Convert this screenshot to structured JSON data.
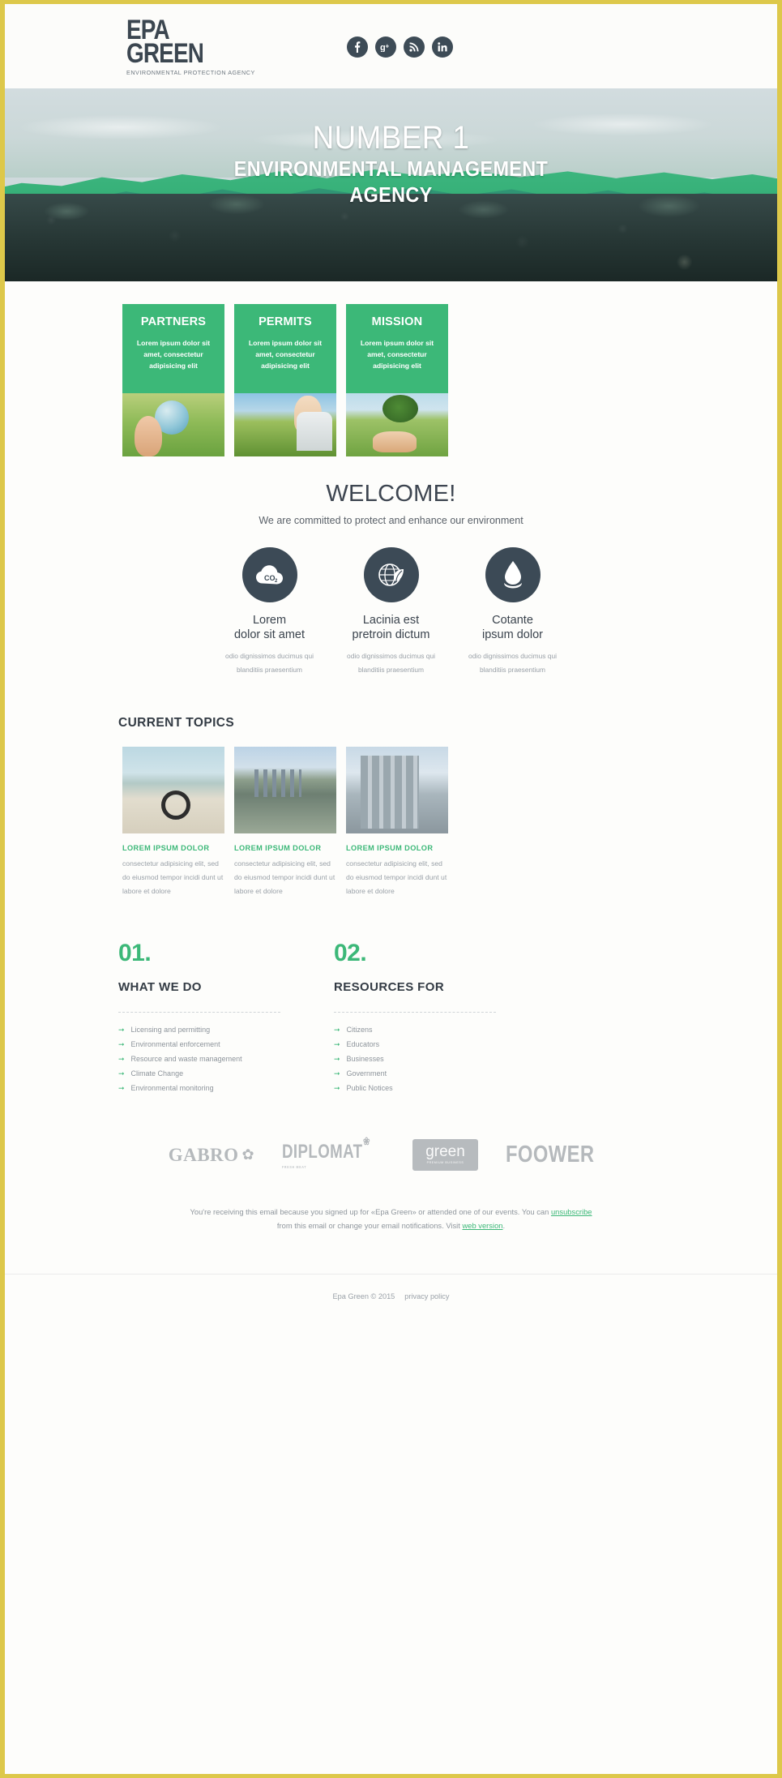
{
  "brand": {
    "logo_line1": "EPA",
    "logo_line2": "GREEN",
    "logo_tagline": "ENVIRONMENTAL PROTECTION AGENCY"
  },
  "social": [
    {
      "name": "facebook-icon",
      "glyph": "f"
    },
    {
      "name": "google-plus-icon",
      "glyph": "g+"
    },
    {
      "name": "rss-icon",
      "glyph": "◜"
    },
    {
      "name": "linkedin-icon",
      "glyph": "in"
    }
  ],
  "hero": {
    "title": "NUMBER 1",
    "subtitle_line1": "ENVIRONMENTAL MANAGEMENT",
    "subtitle_line2": "AGENCY"
  },
  "cards": [
    {
      "title": "PARTNERS",
      "text": "Lorem ipsum dolor sit amet, consectetur adipisicing elit",
      "image_name": "hand-holding-globe-photo"
    },
    {
      "title": "PERMITS",
      "text": "Lorem ipsum dolor sit amet, consectetur adipisicing elit",
      "image_name": "scientist-in-field-photo"
    },
    {
      "title": "MISSION",
      "text": "Lorem ipsum dolor sit amet, consectetur adipisicing elit",
      "image_name": "hands-planting-sapling-photo"
    }
  ],
  "welcome": {
    "title": "WELCOME!",
    "subtitle": "We are committed to protect and enhance our environment"
  },
  "features": [
    {
      "icon": "co2-cloud-icon",
      "title_line1": "Lorem",
      "title_line2": "dolor sit amet",
      "desc_line1": "odio dignissimos ducimus qui",
      "desc_line2": "blanditiis praesentium"
    },
    {
      "icon": "globe-leaf-icon",
      "title_line1": "Lacinia est",
      "title_line2": "pretroin dictum",
      "desc_line1": "odio dignissimos ducimus qui",
      "desc_line2": "blanditiis praesentium"
    },
    {
      "icon": "water-drop-icon",
      "title_line1": "Cotante",
      "title_line2": "ipsum dolor",
      "desc_line1": "odio dignissimos ducimus qui",
      "desc_line2": "blanditiis praesentium"
    }
  ],
  "topics_section": {
    "heading": "CURRENT TOPICS",
    "items": [
      {
        "image_name": "beach-with-tire-photo",
        "title": "LOREM IPSUM DOLOR",
        "text": "consectetur adipisicing elit, sed do eiusmod tempor incidi dunt ut labore et dolore"
      },
      {
        "image_name": "polluted-river-city-photo",
        "title": "LOREM IPSUM DOLOR",
        "text": "consectetur adipisicing elit, sed do eiusmod tempor incidi dunt ut labore et dolore"
      },
      {
        "image_name": "skyscrapers-photo",
        "title": "LOREM IPSUM DOLOR",
        "text": "consectetur adipisicing elit, sed do eiusmod tempor incidi dunt ut labore et dolore"
      }
    ]
  },
  "numbered_columns": [
    {
      "number": "01.",
      "heading": "WHAT WE DO",
      "items": [
        "Licensing and permitting",
        "Environmental enforcement",
        "Resource and waste management",
        "Climate Change",
        "Environmental monitoring"
      ]
    },
    {
      "number": "02.",
      "heading": "RESOURCES FOR",
      "items": [
        "Citizens",
        "Educators",
        "Businesses",
        "Government",
        "Public Notices"
      ]
    }
  ],
  "partner_logos": [
    {
      "name": "gabro-logo",
      "text": "GABRO",
      "mark": "✿"
    },
    {
      "name": "diplomat-logo",
      "text": "DIPLOMAT",
      "sub": "FRESH MEAT",
      "mark": "❀"
    },
    {
      "name": "green-logo",
      "text": "green",
      "sub": "PREMIUM BUSINESS"
    },
    {
      "name": "foower-logo",
      "text": "FOOWER"
    }
  ],
  "footer": {
    "note_part1": "You're receiving this email because you signed up for «Epa Green» or attended one of our events. You can ",
    "unsubscribe_link": "unsubscribe",
    "note_part2": " from this email or change your email notifications. Visit ",
    "web_version_link": "web version",
    "note_part3": ".",
    "copyright": "Epa Green © 2015",
    "privacy_link": "privacy policy"
  },
  "colors": {
    "accent_green": "#3cb878",
    "dark_slate": "#3c4a56",
    "border_yellow": "#ddc84a"
  }
}
